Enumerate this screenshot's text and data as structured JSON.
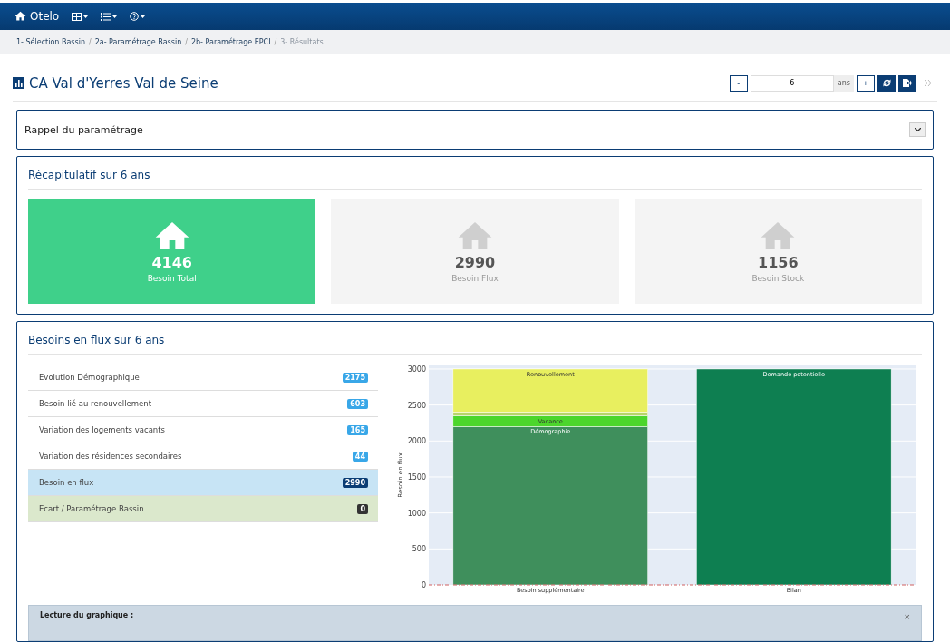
{
  "navbar": {
    "brand": "Otelo",
    "menus": [
      {
        "kind": "grid"
      },
      {
        "kind": "list"
      },
      {
        "kind": "help"
      }
    ]
  },
  "breadcrumb": [
    {
      "label": "1- Sélection Bassin",
      "active": false
    },
    {
      "sep": "/",
      "label": "2a- Paramétrage Bassin",
      "active": false
    },
    {
      "sep": "/",
      "label": "2b- Paramétrage EPCI",
      "active": false
    },
    {
      "sep": "/",
      "label": "3- Résultats",
      "active": true
    }
  ],
  "title": "CA Val d'Yerres Val de Seine",
  "horizon": {
    "minus": "-",
    "value": "6",
    "unit": "ans",
    "plus": "+"
  },
  "reminder_panel": {
    "title": "Rappel du paramétrage",
    "expanded": false
  },
  "summary": {
    "title": "Récapitulatif sur 6 ans",
    "cards": [
      {
        "value": "4146",
        "label": "Besoin Total",
        "selected": true
      },
      {
        "value": "2990",
        "label": "Besoin Flux",
        "selected": false
      },
      {
        "value": "1156",
        "label": "Besoin Stock",
        "selected": false
      }
    ]
  },
  "flux": {
    "title": "Besoins en flux sur 6 ans",
    "items": [
      {
        "label": "Evolution Démographique",
        "count": "2175",
        "kind": "plain"
      },
      {
        "label": "Besoin lié au renouvellement",
        "count": "603",
        "kind": "plain"
      },
      {
        "label": "Variation des logements vacants",
        "count": "165",
        "kind": "plain"
      },
      {
        "label": "Variation des résidences secondaires",
        "count": "44",
        "kind": "plain"
      },
      {
        "label": "Besoin en flux",
        "count": "2990",
        "kind": "total"
      },
      {
        "label": "Ecart / Paramétrage Bassin",
        "count": "0",
        "kind": "gap"
      }
    ],
    "chart_data": {
      "type": "bar",
      "stacked": true,
      "grid": true,
      "ylabel": "Besoin en flux",
      "categories": [
        "Besoin supplémentaire",
        "Bilan"
      ],
      "ylim": [
        0,
        3050
      ],
      "yticks": [
        0,
        500,
        1000,
        1500,
        2000,
        2500,
        3000
      ],
      "series": [
        {
          "name": "Démographie",
          "color": "#3f8f5c",
          "values": [
            2200,
            null
          ]
        },
        {
          "name": "Vacance",
          "color": "#4cd62c",
          "values": [
            150,
            null
          ]
        },
        {
          "color": "#b8d46a",
          "values": [
            50,
            null
          ]
        },
        {
          "name": "Renouvellement",
          "color": "#e8ef5f",
          "values": [
            600,
            null
          ]
        },
        {
          "name": "Demande potentielle",
          "color": "#0e7f51",
          "values": [
            null,
            3000
          ]
        }
      ]
    }
  },
  "note": {
    "title": "Lecture du graphique :",
    "close": "×"
  }
}
